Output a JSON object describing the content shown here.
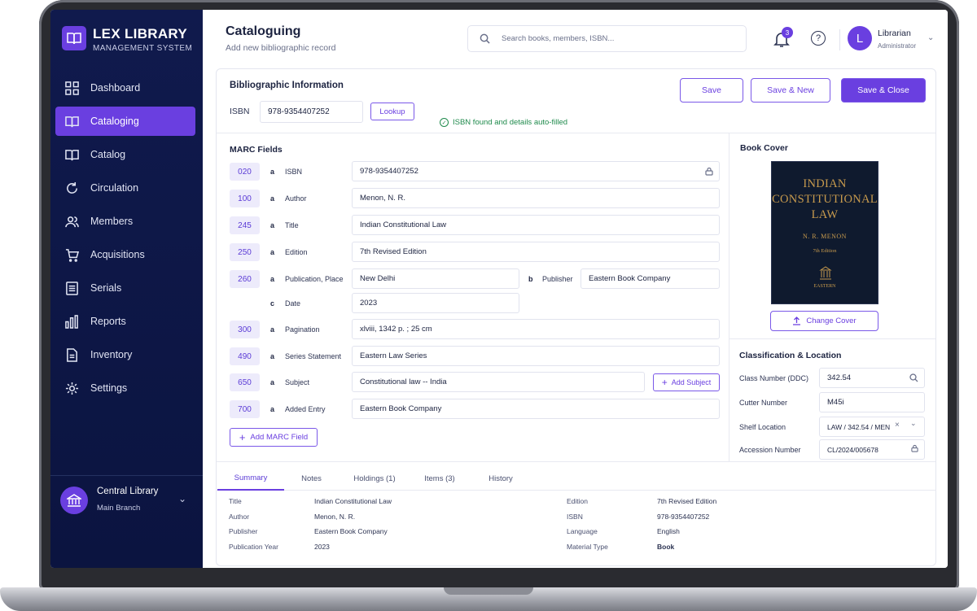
{
  "app": {
    "name": "LEX LIBRARY",
    "subtitle": "MANAGEMENT SYSTEM"
  },
  "sidebar": {
    "items": [
      {
        "label": "Dashboard",
        "icon": "dashboard-icon"
      },
      {
        "label": "Cataloging",
        "icon": "book-open-icon",
        "active": true
      },
      {
        "label": "Catalog",
        "icon": "book-icon"
      },
      {
        "label": "Circulation",
        "icon": "refresh-icon"
      },
      {
        "label": "Members",
        "icon": "users-icon"
      },
      {
        "label": "Acquisitions",
        "icon": "cart-icon"
      },
      {
        "label": "Serials",
        "icon": "document-list-icon"
      },
      {
        "label": "Reports",
        "icon": "bar-chart-icon"
      },
      {
        "label": "Inventory",
        "icon": "file-icon"
      },
      {
        "label": "Settings",
        "icon": "gear-icon"
      }
    ],
    "branch": {
      "name": "Central Library",
      "sub": "Main Branch"
    }
  },
  "header": {
    "title": "Cataloguing",
    "subtitle": "Add new bibliographic record",
    "search_placeholder": "Search books, members, ISBN...",
    "notification_count": "3",
    "user": {
      "initial": "L",
      "name": "Librarian",
      "role": "Administrator"
    }
  },
  "biblio": {
    "title": "Bibliographic Information",
    "isbn_label": "ISBN",
    "isbn_value": "978-9354407252",
    "lookup_label": "Lookup",
    "status_msg": "ISBN found and details auto-filled",
    "buttons": {
      "save": "Save",
      "save_new": "Save & New",
      "save_close": "Save & Close"
    }
  },
  "marc": {
    "title": "MARC Fields",
    "fields": [
      {
        "tag": "020",
        "sub": "a",
        "label": "ISBN",
        "value": "978-9354407252",
        "locked": true
      },
      {
        "tag": "100",
        "sub": "a",
        "label": "Author",
        "value": "Menon, N. R."
      },
      {
        "tag": "245",
        "sub": "a",
        "label": "Title",
        "value": "Indian Constitutional Law"
      },
      {
        "tag": "250",
        "sub": "a",
        "label": "Edition",
        "value": "7th Revised Edition"
      },
      {
        "tag": "260",
        "sub": "a",
        "label": "Publication, Place",
        "value": "New Delhi",
        "sub2": "b",
        "label2": "Publisher",
        "value2": "Eastern Book Company"
      },
      {
        "tag": "",
        "sub": "c",
        "label": "Date",
        "value": "2023"
      },
      {
        "tag": "300",
        "sub": "a",
        "label": "Pagination",
        "value": "xlviii, 1342 p. ; 25 cm"
      },
      {
        "tag": "490",
        "sub": "a",
        "label": "Series Statement",
        "value": "Eastern Law Series"
      },
      {
        "tag": "650",
        "sub": "a",
        "label": "Subject",
        "value": "Constitutional law -- India"
      },
      {
        "tag": "700",
        "sub": "a",
        "label": "Added Entry",
        "value": "Eastern Book Company"
      }
    ],
    "add_subject_label": "Add Subject",
    "add_field_label": "Add MARC Field"
  },
  "cover": {
    "title": "Book Cover",
    "book_title": "INDIAN CONSTITUTIONAL LAW",
    "book_author": "N. R. MENON",
    "book_edition": "7th Edition",
    "publisher_mark": "EASTERN",
    "change_label": "Change Cover"
  },
  "classification": {
    "title": "Classification & Location",
    "rows": [
      {
        "label": "Class Number (DDC)",
        "value": "342.54"
      },
      {
        "label": "Cutter Number",
        "value": "M45i"
      },
      {
        "label": "Shelf Location",
        "value": "LAW / 342.54 / MEN"
      },
      {
        "label": "Accession Number",
        "value": "CL/2024/005678"
      }
    ]
  },
  "tabs": [
    "Summary",
    "Notes",
    "Holdings (1)",
    "Items (3)",
    "History"
  ],
  "summary": {
    "left": [
      {
        "k": "Title",
        "v": "Indian Constitutional Law"
      },
      {
        "k": "Author",
        "v": "Menon, N. R."
      },
      {
        "k": "Publisher",
        "v": "Eastern Book Company"
      },
      {
        "k": "Publication Year",
        "v": "2023"
      }
    ],
    "right": [
      {
        "k": "Edition",
        "v": "7th Revised Edition"
      },
      {
        "k": "ISBN",
        "v": "978-9354407252"
      },
      {
        "k": "Language",
        "v": "English"
      },
      {
        "k": "Material Type",
        "v": "Book"
      }
    ]
  },
  "colors": {
    "accent": "#6a3fe0",
    "sidebar": "#0f1848",
    "success": "#1f8a4c"
  }
}
